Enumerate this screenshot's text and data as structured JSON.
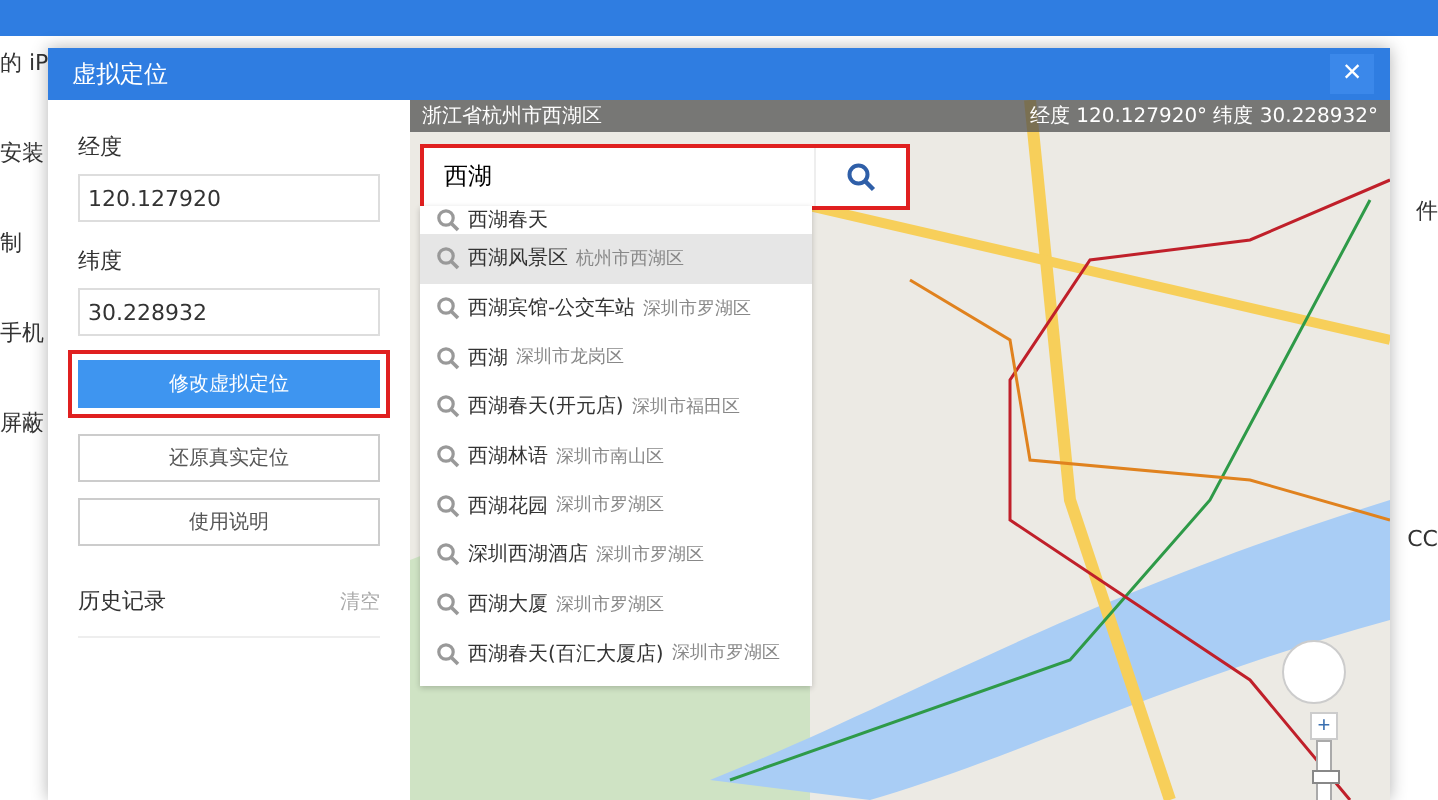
{
  "background_app": {
    "left_labels": [
      "的 iP",
      "安装",
      "制",
      "手机",
      "屏蔽"
    ],
    "right_labels": [
      "件",
      "CC"
    ]
  },
  "dialog": {
    "title": "虚拟定位",
    "close": "×"
  },
  "form": {
    "longitude_label": "经度",
    "longitude": "120.127920",
    "latitude_label": "纬度",
    "latitude": "30.228932"
  },
  "buttons": [
    {
      "label": "修改虚拟定位",
      "kind": "primary"
    },
    {
      "label": "还原真实定位",
      "kind": "secondary"
    },
    {
      "label": "使用说明",
      "kind": "secondary"
    }
  ],
  "history": {
    "title": "历史记录",
    "clear": "清空"
  },
  "map_bar": {
    "address": "浙江省杭州市西湖区",
    "coords": "经度 120.127920° 纬度 30.228932°"
  },
  "search": {
    "value": "西湖"
  },
  "zoom": {
    "plus": "+",
    "level": 0.75
  },
  "suggestions": [
    {
      "name": "西湖春天",
      "selected": false
    },
    {
      "name": "西湖风景区",
      "area": "杭州市西湖区",
      "selected": true
    },
    {
      "name": "西湖宾馆-公交车站",
      "area": "深圳市罗湖区",
      "selected": false
    },
    {
      "name": "西湖",
      "area": "深圳市龙岗区",
      "selected": false
    },
    {
      "name": "西湖春天(开元店)",
      "area": "深圳市福田区",
      "selected": false
    },
    {
      "name": "西湖林语",
      "area": "深圳市南山区",
      "selected": false
    },
    {
      "name": "西湖花园",
      "area": "深圳市罗湖区",
      "selected": false
    },
    {
      "name": "深圳西湖酒店",
      "area": "深圳市罗湖区",
      "selected": false
    },
    {
      "name": "西湖大厦",
      "area": "深圳市罗湖区",
      "selected": false
    },
    {
      "name": "西湖春天(百汇大厦店)",
      "area": "深圳市罗湖区",
      "selected": false
    }
  ]
}
